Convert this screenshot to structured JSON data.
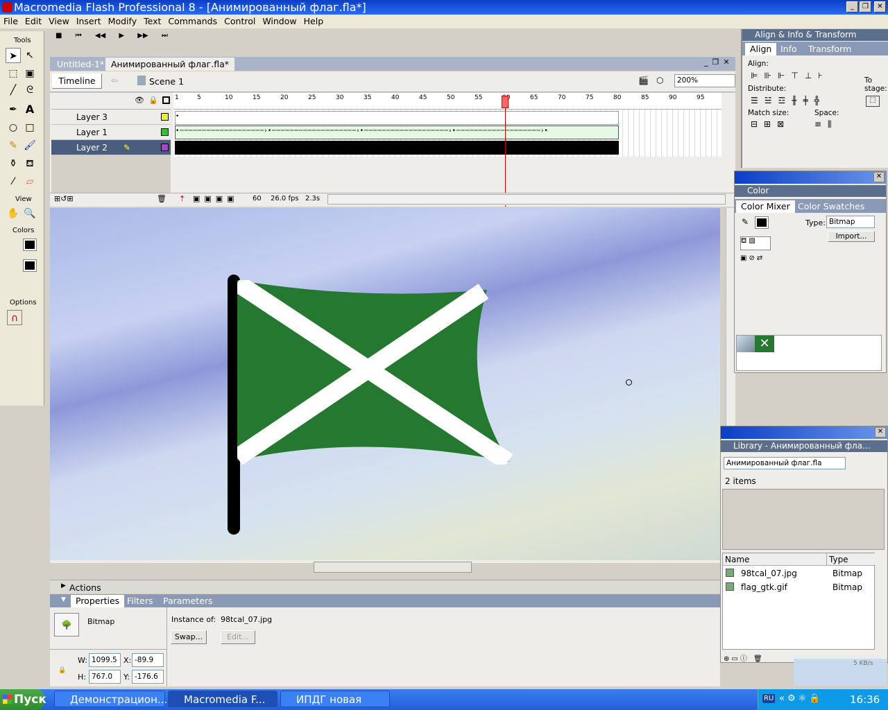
{
  "window": {
    "title": "Macromedia Flash Professional 8 - [Анимированный флаг.fla*]"
  },
  "menu": [
    "File",
    "Edit",
    "View",
    "Insert",
    "Modify",
    "Text",
    "Commands",
    "Control",
    "Window",
    "Help"
  ],
  "tools": {
    "label": "Tools",
    "view_label": "View",
    "colors_label": "Colors",
    "options_label": "Options"
  },
  "doc_tabs": [
    "Untitled-1*",
    "Анимированный флаг.fla*"
  ],
  "timeline": {
    "tab": "Timeline",
    "scene": "Scene 1",
    "zoom": "200%",
    "frame": "60",
    "fps": "26.0 fps",
    "time": "2.3s",
    "ruler": [
      "1",
      "5",
      "10",
      "15",
      "20",
      "25",
      "30",
      "35",
      "40",
      "45",
      "50",
      "55",
      "60",
      "65",
      "70",
      "75",
      "80",
      "85",
      "90",
      "95"
    ],
    "layers": [
      "Layer 3",
      "Layer 1",
      "Layer 2"
    ]
  },
  "bottom_panels": {
    "actions": "Actions",
    "tabs": [
      "Properties",
      "Filters",
      "Parameters"
    ],
    "type": "Bitmap",
    "instance_label": "Instance of:",
    "instance_value": "98tcal_07.jpg",
    "swap": "Swap...",
    "edit": "Edit...",
    "w_label": "W:",
    "w": "1099.5",
    "h_label": "H:",
    "h": "767.0",
    "x_label": "X:",
    "x": "-89.9",
    "y_label": "Y:",
    "y": "-176.6"
  },
  "align_panel": {
    "title": "Align & Info & Transform",
    "tabs": [
      "Align",
      "Info",
      "Transform"
    ],
    "align": "Align:",
    "distribute": "Distribute:",
    "match": "Match size:",
    "space": "Space:",
    "to_stage": "To stage:"
  },
  "color_panel": {
    "title": "Color",
    "tabs": [
      "Color Mixer",
      "Color Swatches"
    ],
    "type_label": "Type:",
    "type_value": "Bitmap",
    "import": "Import..."
  },
  "library_panel": {
    "title": "Library - Анимированный фла...",
    "doc": "Анимированный флаг.fla",
    "count": "2 items",
    "col_name": "Name",
    "col_type": "Type",
    "items": [
      {
        "name": "98tcal_07.jpg",
        "type": "Bitmap"
      },
      {
        "name": "flag_gtk.gif",
        "type": "Bitmap"
      }
    ],
    "net": "5 KB/s"
  },
  "taskbar": {
    "start": "Пуск",
    "items": [
      "Демонстрацион...",
      "Macromedia F...",
      "ИПДГ новая"
    ],
    "lang": "RU",
    "clock": "16:36"
  },
  "colors": {
    "flag_green": "#247830",
    "title_blue": "#0a3fc6",
    "taskbar_blue": "#245edb"
  }
}
